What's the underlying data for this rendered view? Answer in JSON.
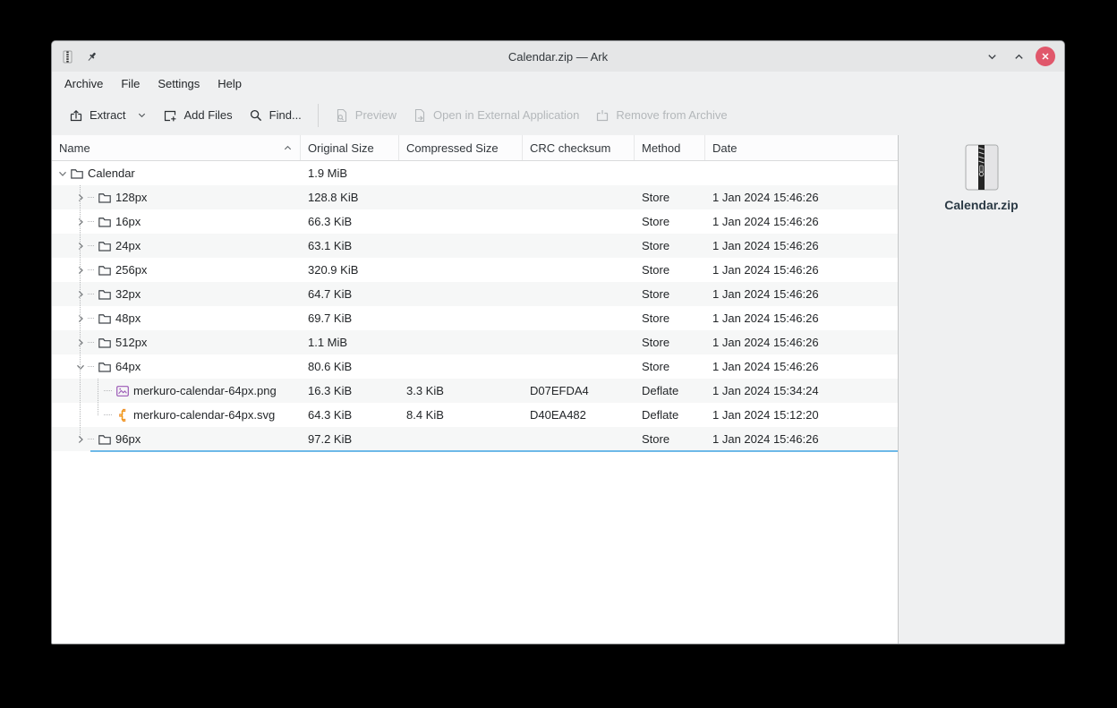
{
  "window": {
    "title": "Calendar.zip — Ark",
    "accent": "#3daee9",
    "close_button_color": "#e0576b"
  },
  "menubar": {
    "items": [
      {
        "label": "Archive"
      },
      {
        "label": "File"
      },
      {
        "label": "Settings"
      },
      {
        "label": "Help"
      }
    ]
  },
  "toolbar": {
    "buttons": [
      {
        "label": "Extract",
        "enabled": true,
        "has_dropdown": true
      },
      {
        "label": "Add Files",
        "enabled": true
      },
      {
        "label": "Find...",
        "enabled": true
      },
      {
        "label": "Preview",
        "enabled": false
      },
      {
        "label": "Open in External Application",
        "enabled": false
      },
      {
        "label": "Remove from Archive",
        "enabled": false
      }
    ]
  },
  "table": {
    "columns": [
      {
        "label": "Name",
        "sorted": "ascending"
      },
      {
        "label": "Original Size"
      },
      {
        "label": "Compressed Size"
      },
      {
        "label": "CRC checksum"
      },
      {
        "label": "Method"
      },
      {
        "label": "Date"
      }
    ],
    "rows": [
      {
        "name": "Calendar",
        "type": "folder",
        "depth": 0,
        "expanded": true,
        "original_size": "1.9 MiB",
        "compressed_size": "",
        "crc": "",
        "method": "",
        "date": ""
      },
      {
        "name": "128px",
        "type": "folder",
        "depth": 1,
        "expanded": false,
        "original_size": "128.8 KiB",
        "compressed_size": "",
        "crc": "",
        "method": "Store",
        "date": "1 Jan 2024 15:46:26"
      },
      {
        "name": "16px",
        "type": "folder",
        "depth": 1,
        "expanded": false,
        "original_size": "66.3 KiB",
        "compressed_size": "",
        "crc": "",
        "method": "Store",
        "date": "1 Jan 2024 15:46:26"
      },
      {
        "name": "24px",
        "type": "folder",
        "depth": 1,
        "expanded": false,
        "original_size": "63.1 KiB",
        "compressed_size": "",
        "crc": "",
        "method": "Store",
        "date": "1 Jan 2024 15:46:26"
      },
      {
        "name": "256px",
        "type": "folder",
        "depth": 1,
        "expanded": false,
        "original_size": "320.9 KiB",
        "compressed_size": "",
        "crc": "",
        "method": "Store",
        "date": "1 Jan 2024 15:46:26"
      },
      {
        "name": "32px",
        "type": "folder",
        "depth": 1,
        "expanded": false,
        "original_size": "64.7 KiB",
        "compressed_size": "",
        "crc": "",
        "method": "Store",
        "date": "1 Jan 2024 15:46:26"
      },
      {
        "name": "48px",
        "type": "folder",
        "depth": 1,
        "expanded": false,
        "original_size": "69.7 KiB",
        "compressed_size": "",
        "crc": "",
        "method": "Store",
        "date": "1 Jan 2024 15:46:26"
      },
      {
        "name": "512px",
        "type": "folder",
        "depth": 1,
        "expanded": false,
        "original_size": "1.1 MiB",
        "compressed_size": "",
        "crc": "",
        "method": "Store",
        "date": "1 Jan 2024 15:46:26"
      },
      {
        "name": "64px",
        "type": "folder",
        "depth": 1,
        "expanded": true,
        "original_size": "80.6 KiB",
        "compressed_size": "",
        "crc": "",
        "method": "Store",
        "date": "1 Jan 2024 15:46:26"
      },
      {
        "name": "merkuro-calendar-64px.png",
        "type": "image-file",
        "depth": 2,
        "original_size": "16.3 KiB",
        "compressed_size": "3.3 KiB",
        "crc": "D07EFDA4",
        "method": "Deflate",
        "date": "1 Jan 2024 15:34:24"
      },
      {
        "name": "merkuro-calendar-64px.svg",
        "type": "vector-file",
        "depth": 2,
        "original_size": "64.3 KiB",
        "compressed_size": "8.4 KiB",
        "crc": "D40EA482",
        "method": "Deflate",
        "date": "1 Jan 2024 15:12:20"
      },
      {
        "name": "96px",
        "type": "folder",
        "depth": 1,
        "expanded": false,
        "original_size": "97.2 KiB",
        "compressed_size": "",
        "crc": "",
        "method": "Store",
        "date": "1 Jan 2024 15:46:26"
      }
    ]
  },
  "sidepanel": {
    "archive_name": "Calendar.zip"
  }
}
